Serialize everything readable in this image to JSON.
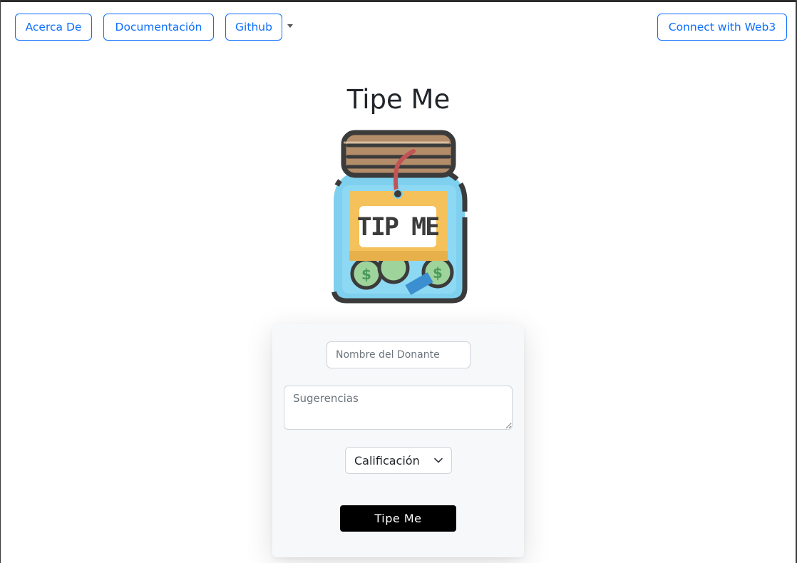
{
  "nav": {
    "about_label": "Acerca De",
    "docs_label": "Documentación",
    "github_label": "Github",
    "connect_label": "Connect with Web3"
  },
  "page": {
    "title": "Tipe Me"
  },
  "jar_image": {
    "tag_text": "TIP ME",
    "icon": "tip-jar-icon"
  },
  "form": {
    "name_placeholder": "Nombre del Donante",
    "suggestions_placeholder": "Sugerencias",
    "rating_selected": "Calificación",
    "submit_label": "Tipe Me"
  },
  "colors": {
    "primary": "#0d6efd",
    "button_dark": "#000000",
    "card_bg": "#f7f8f9"
  }
}
